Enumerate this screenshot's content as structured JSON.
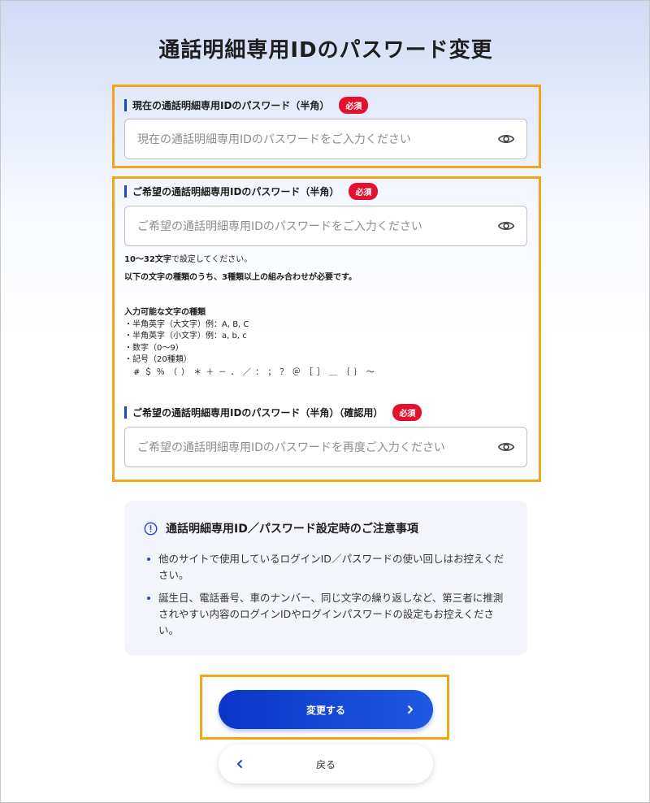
{
  "page": {
    "title": "通話明細専用IDのパスワード変更"
  },
  "current_password": {
    "label": "現在の通話明細専用IDのパスワード（半角）",
    "required_badge": "必須",
    "placeholder": "現在の通話明細専用IDのパスワードをご入力ください",
    "toggle_icon": "eye-icon"
  },
  "new_password": {
    "label": "ご希望の通話明細専用IDのパスワード（半角）",
    "required_badge": "必須",
    "placeholder": "ご希望の通話明細専用IDのパスワードをご入力ください",
    "toggle_icon": "eye-icon",
    "rule_length_bold": "10〜32文字",
    "rule_length_rest": "で設定してください。",
    "rule_combo": "以下の文字の種類のうち、3種類以上の組み合わせが必要です。",
    "char_types_heading": "入力可能な文字の種類",
    "char_types": [
      "・半角英字（大文字）例：A, B, C",
      "・半角英字（小文字）例：a, b, c",
      "・数字（0〜9）",
      "・記号（20種類）"
    ],
    "symbols": "　# ＄ ％ （ ） ＊ ＋ － ． ／ ： ； ？ ＠ ［ ］ ＿ ｛ ｝ ～"
  },
  "confirm_password": {
    "label": "ご希望の通話明細専用IDのパスワード（半角）（確認用）",
    "required_badge": "必須",
    "placeholder": "ご希望の通話明細専用IDのパスワードを再度ご入力ください",
    "toggle_icon": "eye-icon"
  },
  "notice": {
    "icon": "info-icon",
    "heading": "通話明細専用ID／パスワード設定時のご注意事項",
    "items": [
      "他のサイトで使用しているログインID／パスワードの使い回しはお控えください。",
      "誕生日、電話番号、車のナンバー、同じ文字の繰り返しなど、第三者に推測されやすい内容のログインIDやログインパスワードの設定もお控えください。"
    ]
  },
  "buttons": {
    "submit_label": "変更する",
    "back_label": "戻る"
  },
  "colors": {
    "accent_blue": "#1b46c4",
    "required_red": "#e3112d",
    "highlight_orange": "#f1a619"
  }
}
